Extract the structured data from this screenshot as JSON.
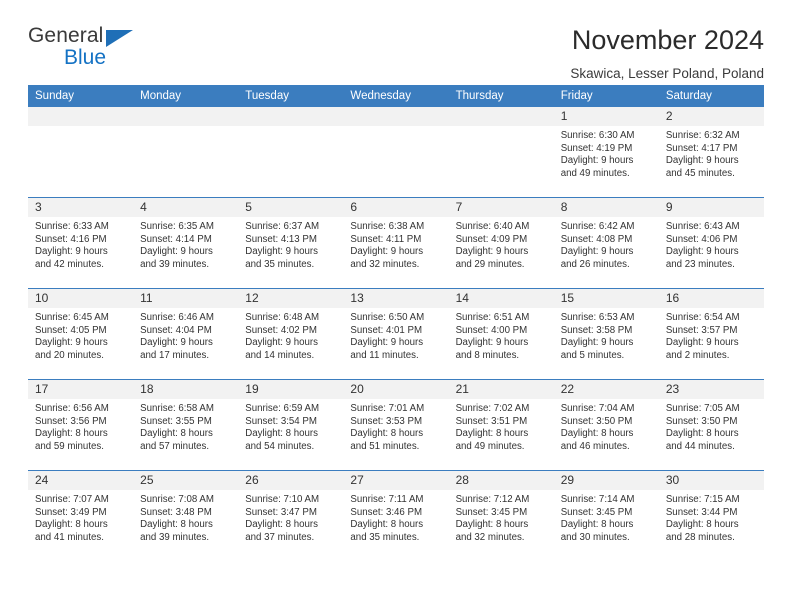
{
  "brand": {
    "name_dark": "General",
    "name_blue": "Blue",
    "triangle_icon": "triangle-icon",
    "accent_blue": "#1472c4",
    "header_blue": "#3b7dbf"
  },
  "header": {
    "title": "November 2024",
    "subtitle": "Skawica, Lesser Poland, Poland"
  },
  "calendar": {
    "weekday_headers": [
      "Sunday",
      "Monday",
      "Tuesday",
      "Wednesday",
      "Thursday",
      "Friday",
      "Saturday"
    ],
    "weeks": [
      [
        {
          "day": "",
          "empty": true,
          "sunrise": "",
          "sunset": "",
          "daylight_line1": "",
          "daylight_line2": ""
        },
        {
          "day": "",
          "empty": true,
          "sunrise": "",
          "sunset": "",
          "daylight_line1": "",
          "daylight_line2": ""
        },
        {
          "day": "",
          "empty": true,
          "sunrise": "",
          "sunset": "",
          "daylight_line1": "",
          "daylight_line2": ""
        },
        {
          "day": "",
          "empty": true,
          "sunrise": "",
          "sunset": "",
          "daylight_line1": "",
          "daylight_line2": ""
        },
        {
          "day": "",
          "empty": true,
          "sunrise": "",
          "sunset": "",
          "daylight_line1": "",
          "daylight_line2": ""
        },
        {
          "day": "1",
          "empty": false,
          "sunrise": "Sunrise: 6:30 AM",
          "sunset": "Sunset: 4:19 PM",
          "daylight_line1": "Daylight: 9 hours",
          "daylight_line2": "and 49 minutes."
        },
        {
          "day": "2",
          "empty": false,
          "sunrise": "Sunrise: 6:32 AM",
          "sunset": "Sunset: 4:17 PM",
          "daylight_line1": "Daylight: 9 hours",
          "daylight_line2": "and 45 minutes."
        }
      ],
      [
        {
          "day": "3",
          "empty": false,
          "sunrise": "Sunrise: 6:33 AM",
          "sunset": "Sunset: 4:16 PM",
          "daylight_line1": "Daylight: 9 hours",
          "daylight_line2": "and 42 minutes."
        },
        {
          "day": "4",
          "empty": false,
          "sunrise": "Sunrise: 6:35 AM",
          "sunset": "Sunset: 4:14 PM",
          "daylight_line1": "Daylight: 9 hours",
          "daylight_line2": "and 39 minutes."
        },
        {
          "day": "5",
          "empty": false,
          "sunrise": "Sunrise: 6:37 AM",
          "sunset": "Sunset: 4:13 PM",
          "daylight_line1": "Daylight: 9 hours",
          "daylight_line2": "and 35 minutes."
        },
        {
          "day": "6",
          "empty": false,
          "sunrise": "Sunrise: 6:38 AM",
          "sunset": "Sunset: 4:11 PM",
          "daylight_line1": "Daylight: 9 hours",
          "daylight_line2": "and 32 minutes."
        },
        {
          "day": "7",
          "empty": false,
          "sunrise": "Sunrise: 6:40 AM",
          "sunset": "Sunset: 4:09 PM",
          "daylight_line1": "Daylight: 9 hours",
          "daylight_line2": "and 29 minutes."
        },
        {
          "day": "8",
          "empty": false,
          "sunrise": "Sunrise: 6:42 AM",
          "sunset": "Sunset: 4:08 PM",
          "daylight_line1": "Daylight: 9 hours",
          "daylight_line2": "and 26 minutes."
        },
        {
          "day": "9",
          "empty": false,
          "sunrise": "Sunrise: 6:43 AM",
          "sunset": "Sunset: 4:06 PM",
          "daylight_line1": "Daylight: 9 hours",
          "daylight_line2": "and 23 minutes."
        }
      ],
      [
        {
          "day": "10",
          "empty": false,
          "sunrise": "Sunrise: 6:45 AM",
          "sunset": "Sunset: 4:05 PM",
          "daylight_line1": "Daylight: 9 hours",
          "daylight_line2": "and 20 minutes."
        },
        {
          "day": "11",
          "empty": false,
          "sunrise": "Sunrise: 6:46 AM",
          "sunset": "Sunset: 4:04 PM",
          "daylight_line1": "Daylight: 9 hours",
          "daylight_line2": "and 17 minutes."
        },
        {
          "day": "12",
          "empty": false,
          "sunrise": "Sunrise: 6:48 AM",
          "sunset": "Sunset: 4:02 PM",
          "daylight_line1": "Daylight: 9 hours",
          "daylight_line2": "and 14 minutes."
        },
        {
          "day": "13",
          "empty": false,
          "sunrise": "Sunrise: 6:50 AM",
          "sunset": "Sunset: 4:01 PM",
          "daylight_line1": "Daylight: 9 hours",
          "daylight_line2": "and 11 minutes."
        },
        {
          "day": "14",
          "empty": false,
          "sunrise": "Sunrise: 6:51 AM",
          "sunset": "Sunset: 4:00 PM",
          "daylight_line1": "Daylight: 9 hours",
          "daylight_line2": "and 8 minutes."
        },
        {
          "day": "15",
          "empty": false,
          "sunrise": "Sunrise: 6:53 AM",
          "sunset": "Sunset: 3:58 PM",
          "daylight_line1": "Daylight: 9 hours",
          "daylight_line2": "and 5 minutes."
        },
        {
          "day": "16",
          "empty": false,
          "sunrise": "Sunrise: 6:54 AM",
          "sunset": "Sunset: 3:57 PM",
          "daylight_line1": "Daylight: 9 hours",
          "daylight_line2": "and 2 minutes."
        }
      ],
      [
        {
          "day": "17",
          "empty": false,
          "sunrise": "Sunrise: 6:56 AM",
          "sunset": "Sunset: 3:56 PM",
          "daylight_line1": "Daylight: 8 hours",
          "daylight_line2": "and 59 minutes."
        },
        {
          "day": "18",
          "empty": false,
          "sunrise": "Sunrise: 6:58 AM",
          "sunset": "Sunset: 3:55 PM",
          "daylight_line1": "Daylight: 8 hours",
          "daylight_line2": "and 57 minutes."
        },
        {
          "day": "19",
          "empty": false,
          "sunrise": "Sunrise: 6:59 AM",
          "sunset": "Sunset: 3:54 PM",
          "daylight_line1": "Daylight: 8 hours",
          "daylight_line2": "and 54 minutes."
        },
        {
          "day": "20",
          "empty": false,
          "sunrise": "Sunrise: 7:01 AM",
          "sunset": "Sunset: 3:53 PM",
          "daylight_line1": "Daylight: 8 hours",
          "daylight_line2": "and 51 minutes."
        },
        {
          "day": "21",
          "empty": false,
          "sunrise": "Sunrise: 7:02 AM",
          "sunset": "Sunset: 3:51 PM",
          "daylight_line1": "Daylight: 8 hours",
          "daylight_line2": "and 49 minutes."
        },
        {
          "day": "22",
          "empty": false,
          "sunrise": "Sunrise: 7:04 AM",
          "sunset": "Sunset: 3:50 PM",
          "daylight_line1": "Daylight: 8 hours",
          "daylight_line2": "and 46 minutes."
        },
        {
          "day": "23",
          "empty": false,
          "sunrise": "Sunrise: 7:05 AM",
          "sunset": "Sunset: 3:50 PM",
          "daylight_line1": "Daylight: 8 hours",
          "daylight_line2": "and 44 minutes."
        }
      ],
      [
        {
          "day": "24",
          "empty": false,
          "sunrise": "Sunrise: 7:07 AM",
          "sunset": "Sunset: 3:49 PM",
          "daylight_line1": "Daylight: 8 hours",
          "daylight_line2": "and 41 minutes."
        },
        {
          "day": "25",
          "empty": false,
          "sunrise": "Sunrise: 7:08 AM",
          "sunset": "Sunset: 3:48 PM",
          "daylight_line1": "Daylight: 8 hours",
          "daylight_line2": "and 39 minutes."
        },
        {
          "day": "26",
          "empty": false,
          "sunrise": "Sunrise: 7:10 AM",
          "sunset": "Sunset: 3:47 PM",
          "daylight_line1": "Daylight: 8 hours",
          "daylight_line2": "and 37 minutes."
        },
        {
          "day": "27",
          "empty": false,
          "sunrise": "Sunrise: 7:11 AM",
          "sunset": "Sunset: 3:46 PM",
          "daylight_line1": "Daylight: 8 hours",
          "daylight_line2": "and 35 minutes."
        },
        {
          "day": "28",
          "empty": false,
          "sunrise": "Sunrise: 7:12 AM",
          "sunset": "Sunset: 3:45 PM",
          "daylight_line1": "Daylight: 8 hours",
          "daylight_line2": "and 32 minutes."
        },
        {
          "day": "29",
          "empty": false,
          "sunrise": "Sunrise: 7:14 AM",
          "sunset": "Sunset: 3:45 PM",
          "daylight_line1": "Daylight: 8 hours",
          "daylight_line2": "and 30 minutes."
        },
        {
          "day": "30",
          "empty": false,
          "sunrise": "Sunrise: 7:15 AM",
          "sunset": "Sunset: 3:44 PM",
          "daylight_line1": "Daylight: 8 hours",
          "daylight_line2": "and 28 minutes."
        }
      ]
    ]
  }
}
